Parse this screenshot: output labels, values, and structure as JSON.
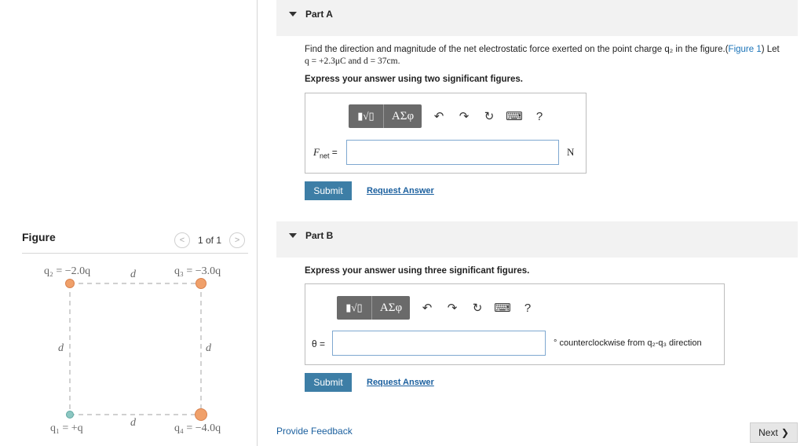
{
  "figure": {
    "title": "Figure",
    "pager_prev": "<",
    "pager_text": "1 of 1",
    "pager_next": ">",
    "labels": {
      "q2": "q₂ = −2.0q",
      "q3": "q₃ = −3.0q",
      "q1": "q₁ = +q",
      "q4": "q₄ = −4.0q",
      "d_top": "d",
      "d_left": "d",
      "d_right": "d",
      "d_bottom": "d"
    },
    "colors": {
      "charge_negative": "#f0a06a",
      "charge_positive": "#8cc7c2",
      "dash": "#b5b5b5"
    }
  },
  "partA": {
    "title": "Part A",
    "prompt_pre": "Find the direction and magnitude of the net electrostatic force exerted on the point charge q₂ in the figure.(",
    "figure_link": "Figure 1",
    "prompt_mid": ") Let",
    "prompt_line2": "q = +2.3μC and d = 37cm.",
    "instruction": "Express your answer using two significant figures.",
    "var_label": "F",
    "var_sub": "net",
    "var_eq": " =",
    "input_value": "",
    "unit": "N",
    "submit": "Submit",
    "request": "Request Answer"
  },
  "partB": {
    "title": "Part B",
    "instruction": "Express your answer using three significant figures.",
    "var_label": "θ =",
    "input_value": "",
    "unit_text": "° counterclockwise from q₂-q₃ direction",
    "submit": "Submit",
    "request": "Request Answer"
  },
  "toolbar": {
    "templates": "▮√▯",
    "greek": "ΑΣφ",
    "undo": "↶",
    "redo": "↷",
    "reset": "↻",
    "keyboard": "⌨",
    "help": "?"
  },
  "footer": {
    "feedback": "Provide Feedback",
    "next": "Next",
    "next_icon": "❯"
  }
}
